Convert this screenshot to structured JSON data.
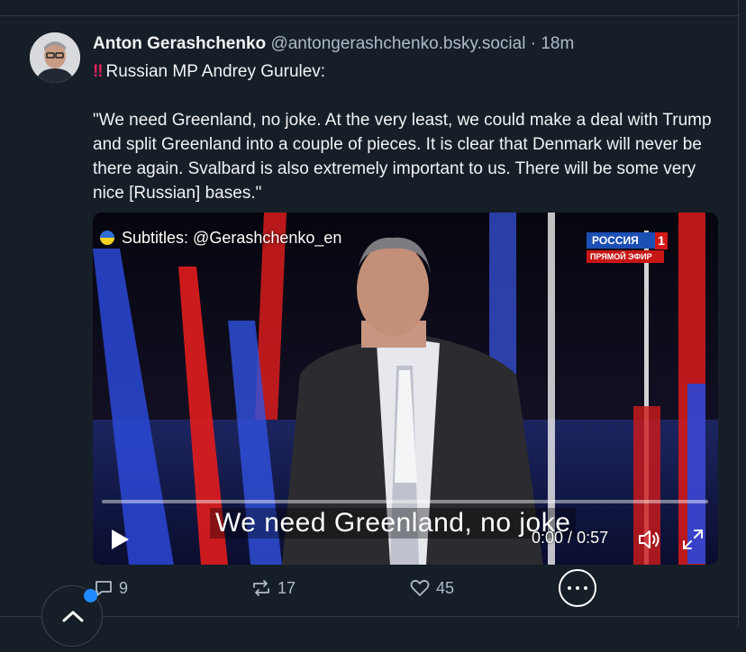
{
  "post": {
    "author_name": "Anton Gerashchenko",
    "handle": "@antongerashchenko.bsky.social",
    "separator": "·",
    "time": "18m",
    "alert_icon": "‼",
    "body_line1": "Russian MP Andrey Gurulev:",
    "body_quote": "\"We need Greenland, no joke. At the very least, we could make a deal with Trump and split Greenland into a couple of pieces. It is clear that Denmark will never be there again. Svalbard is also extremely important to us. There will be some very nice [Russian] bases.\""
  },
  "video": {
    "watermark": "Subtitles: @Gerashchenko_en",
    "channel_name": "РОССИЯ",
    "channel_number": "1",
    "channel_live": "ПРЯМОЙ ЭФИР",
    "subtitle": "We need Greenland, no joke",
    "current_time": "0:00",
    "time_separator": " / ",
    "duration": "0:57",
    "progress_fraction": 0.0
  },
  "actions": {
    "replies": "9",
    "reposts": "17",
    "likes": "45"
  },
  "icons": {
    "reply": "reply-icon",
    "repost": "repost-icon",
    "like": "heart-icon",
    "more": "more-options-icon",
    "play": "play-icon",
    "volume": "volume-icon",
    "fullscreen": "fullscreen-icon",
    "scroll_top": "chevron-up-icon"
  },
  "colors": {
    "background": "#161e27",
    "text": "#f1f3f5",
    "muted": "#aebbc9",
    "accent": "#208bfe",
    "alert": "#e0245e"
  }
}
